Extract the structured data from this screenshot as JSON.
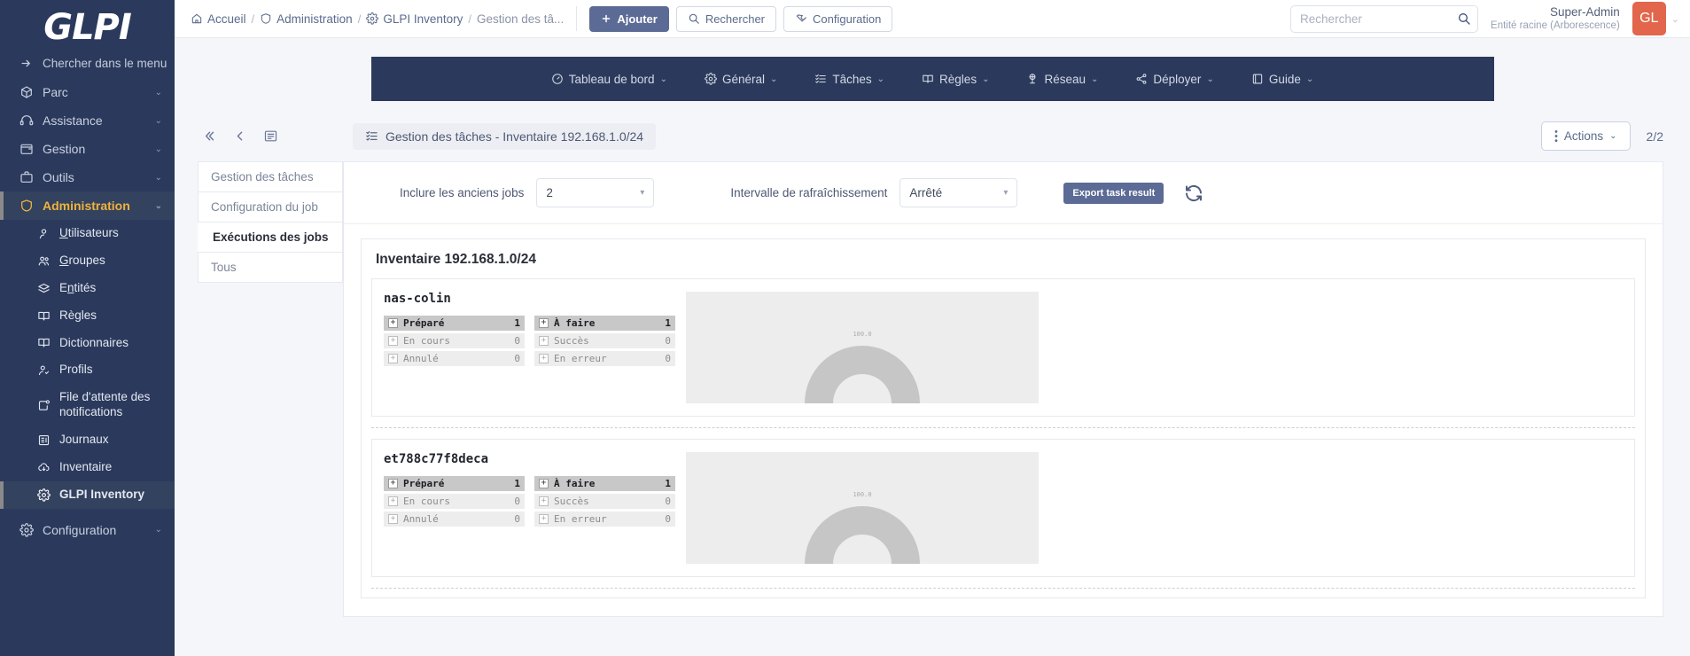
{
  "sidebar": {
    "logo": "GLPI",
    "search_label": "Chercher dans le menu",
    "items": [
      {
        "label": "Parc",
        "icon": "box-icon",
        "chevron": "⌄"
      },
      {
        "label": "Assistance",
        "icon": "headset-icon",
        "chevron": "⌄"
      },
      {
        "label": "Gestion",
        "icon": "wallet-icon",
        "chevron": "⌄"
      },
      {
        "label": "Outils",
        "icon": "briefcase-icon",
        "chevron": "⌄"
      },
      {
        "label": "Administration",
        "icon": "shield-icon",
        "chevron": "⌄"
      }
    ],
    "submenu": [
      {
        "label": "Utilisateurs",
        "icon": "user-icon"
      },
      {
        "label": "Groupes",
        "icon": "users-icon"
      },
      {
        "label": "Entités",
        "icon": "layers-icon"
      },
      {
        "label": "Règles",
        "icon": "book-icon"
      },
      {
        "label": "Dictionnaires",
        "icon": "book-icon"
      },
      {
        "label": "Profils",
        "icon": "user-check-icon"
      },
      {
        "label": "File d'attente des notifications",
        "icon": "notification-icon"
      },
      {
        "label": "Journaux",
        "icon": "journal-icon"
      },
      {
        "label": "Inventaire",
        "icon": "cloud-download-icon"
      },
      {
        "label": "GLPI Inventory",
        "icon": "gear-icon"
      }
    ],
    "footer_item": {
      "label": "Configuration",
      "icon": "gear-icon",
      "chevron": "⌄"
    }
  },
  "topbar": {
    "breadcrumbs": [
      {
        "label": "Accueil",
        "icon": "home-icon"
      },
      {
        "label": "Administration",
        "icon": "shield-icon"
      },
      {
        "label": "GLPI Inventory",
        "icon": "gear-icon"
      },
      {
        "label": "Gestion des tâ...",
        "icon": "none"
      }
    ],
    "separator": "/",
    "add_button": "Ajouter",
    "add_button_icon": "plus-icon",
    "search_button": "Rechercher",
    "search_button_icon": "search-icon",
    "config_button": "Configuration",
    "config_button_icon": "wrench-icon",
    "global_search_placeholder": "Rechercher",
    "global_search_value": "",
    "user_name": "Super-Admin",
    "user_entity": "Entité racine (Arborescence)",
    "avatar_initials": "GL",
    "avatar_color": "#e2664b",
    "avatar_chevron": "⌄"
  },
  "navbar": {
    "tabs": [
      {
        "label": "Tableau de bord",
        "icon": "dashboard-icon",
        "chevron": "⌄"
      },
      {
        "label": "Général",
        "icon": "gear-icon",
        "chevron": "⌄"
      },
      {
        "label": "Tâches",
        "icon": "tasks-icon",
        "chevron": "⌄"
      },
      {
        "label": "Règles",
        "icon": "book-icon",
        "chevron": "⌄"
      },
      {
        "label": "Réseau",
        "icon": "network-icon",
        "chevron": "⌄"
      },
      {
        "label": "Déployer",
        "icon": "share-icon",
        "chevron": "⌄"
      },
      {
        "label": "Guide",
        "icon": "guide-icon",
        "chevron": "⌄"
      }
    ],
    "background": "#2b3a5c"
  },
  "title_row": {
    "collapse_icon": "double-chevron-left-icon",
    "back_icon": "chevron-left-icon",
    "list_icon": "list-icon",
    "page_title": "Gestion des tâches - Inventaire 192.168.1.0/24",
    "page_title_icon": "tasks-icon",
    "actions_label": "Actions",
    "actions_icon": "kebab-icon",
    "actions_chevron": "⌄",
    "counter": "2/2"
  },
  "tabs_col": [
    {
      "label": "Gestion des tâches",
      "active": false
    },
    {
      "label": "Configuration du job",
      "active": false
    },
    {
      "label": "Exécutions des jobs",
      "active": true
    },
    {
      "label": "Tous",
      "active": false
    }
  ],
  "filters": {
    "old_jobs_label": "Inclure les anciens jobs",
    "old_jobs_value": "2",
    "refresh_label": "Intervalle de rafraîchissement",
    "refresh_value": "Arrêté",
    "export_label": "Export task result",
    "refresh_icon": "refresh-icon"
  },
  "inventory": {
    "title": "Inventaire 192.168.1.0/24",
    "jobs": [
      {
        "name": "nas-colin",
        "stats_left": [
          {
            "label": "Préparé",
            "value": "1",
            "highlight": true
          },
          {
            "label": "En cours",
            "value": "0",
            "highlight": false
          },
          {
            "label": "Annulé",
            "value": "0",
            "highlight": false
          }
        ],
        "stats_right": [
          {
            "label": "À faire",
            "value": "1",
            "highlight": true
          },
          {
            "label": "Succès",
            "value": "0",
            "highlight": false
          },
          {
            "label": "En erreur",
            "value": "0",
            "highlight": false
          }
        ],
        "gauge_label": "100.0"
      },
      {
        "name": "et788c77f8deca",
        "stats_left": [
          {
            "label": "Préparé",
            "value": "1",
            "highlight": true
          },
          {
            "label": "En cours",
            "value": "0",
            "highlight": false
          },
          {
            "label": "Annulé",
            "value": "0",
            "highlight": false
          }
        ],
        "stats_right": [
          {
            "label": "À faire",
            "value": "1",
            "highlight": true
          },
          {
            "label": "Succès",
            "value": "0",
            "highlight": false
          },
          {
            "label": "En erreur",
            "value": "0",
            "highlight": false
          }
        ],
        "gauge_label": "100.0"
      }
    ]
  }
}
